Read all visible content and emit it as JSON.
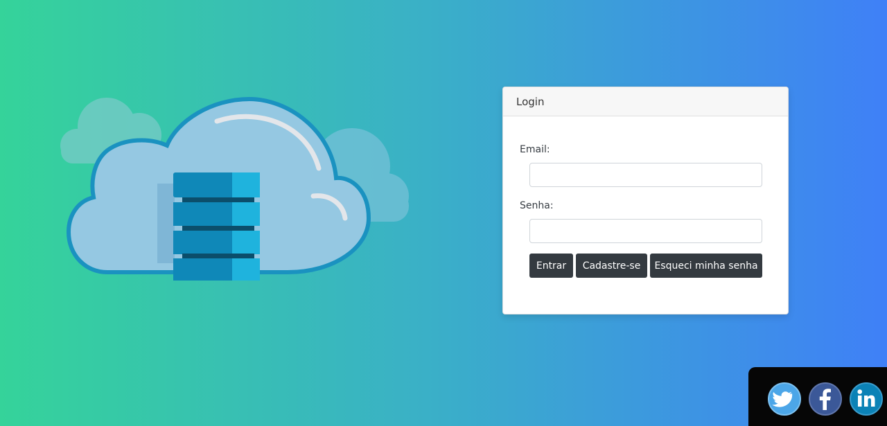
{
  "card": {
    "title": "Login",
    "email_label": "Email:",
    "email_value": "",
    "password_label": "Senha:",
    "password_value": ""
  },
  "buttons": {
    "login": "Entrar",
    "register": "Cadastre-se",
    "forgot": "Esqueci minha senha"
  },
  "hero": {
    "icon": "cloud-server-illustration"
  },
  "social": {
    "items": [
      {
        "name": "twitter",
        "icon": "twitter-icon",
        "color": "#4ca6e8"
      },
      {
        "name": "facebook",
        "icon": "facebook-icon",
        "color": "#3b5898"
      },
      {
        "name": "linkedin",
        "icon": "linkedin-icon",
        "color": "#0b82b6"
      }
    ]
  },
  "colors": {
    "gradient_start": "#35d39a",
    "gradient_end": "#3f80f7",
    "button_bg": "#343a40",
    "social_bar_bg": "#060606"
  }
}
